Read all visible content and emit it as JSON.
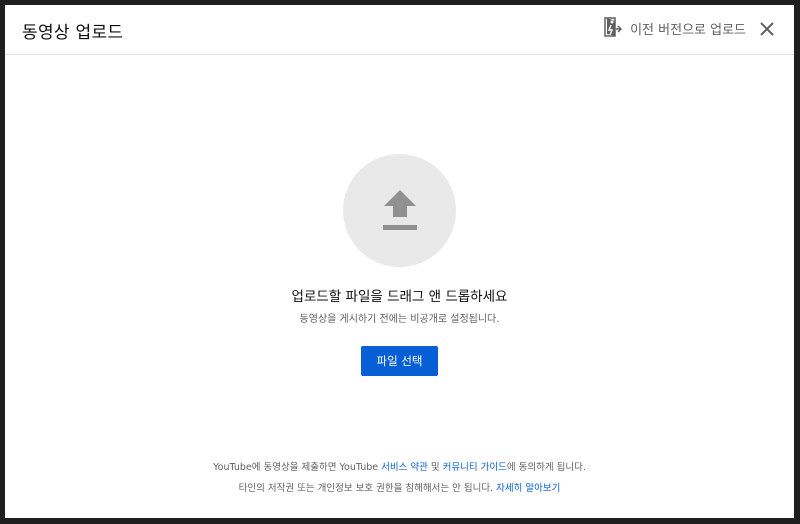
{
  "dialog": {
    "title": "동영상 업로드",
    "legacy_label": "이전 버전으로 업로드",
    "legacy_icon": "legacy-upload-icon",
    "close_icon": "close-icon"
  },
  "upload": {
    "icon": "upload-arrow-icon",
    "headline": "업로드할 파일을 드래그 앤 드롭하세요",
    "subline": "동영상을 게시하기 전에는 비공개로 설정됩니다.",
    "select_button": "파일 선택"
  },
  "footer": {
    "line1_prefix": "YouTube에 동영상을 제출하면 YouTube ",
    "terms_link": "서비스 약관",
    "line1_and": " 및 ",
    "guidelines_link": "커뮤니티 가이드",
    "line1_suffix": "에 동의하게 됩니다.",
    "line2_text": "타인의 저작권 또는 개인정보 보호 권한을 침해해서는 안 됩니다. ",
    "learn_more_link": "자세히 알아보기"
  },
  "colors": {
    "accent": "#065fd4",
    "circle_bg": "#e9e9e9",
    "icon_gray": "#909090"
  }
}
